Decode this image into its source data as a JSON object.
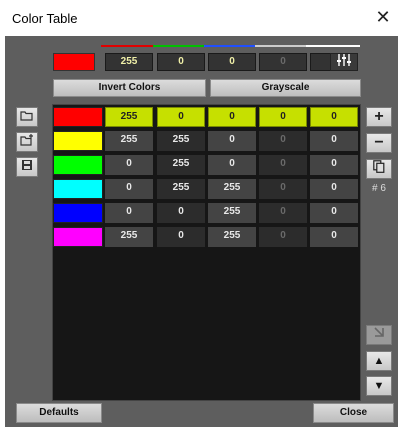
{
  "window": {
    "title": "Color Table",
    "close_glyph": "✕"
  },
  "header": {
    "swatch_color": "#ff0000",
    "channels": [
      {
        "value": "255",
        "dim": false,
        "line_color": "#e00000"
      },
      {
        "value": "0",
        "dim": false,
        "line_color": "#00c000"
      },
      {
        "value": "0",
        "dim": false,
        "line_color": "#2050ff"
      },
      {
        "value": "0",
        "dim": true,
        "line_color": "#cccccc"
      },
      {
        "value": "0",
        "dim": false,
        "line_color": "#ffffff"
      }
    ],
    "settings_icon": "sliders-icon"
  },
  "buttons": {
    "invert": "Invert Colors",
    "grayscale": "Grayscale",
    "defaults": "Defaults",
    "close": "Close"
  },
  "rows": [
    {
      "color": "#ff0000",
      "values": [
        "255",
        "0",
        "0",
        "0",
        "0"
      ],
      "selected": true
    },
    {
      "color": "#ffff00",
      "values": [
        "255",
        "255",
        "0",
        "0",
        "0"
      ],
      "selected": false
    },
    {
      "color": "#00ff00",
      "values": [
        "0",
        "255",
        "0",
        "0",
        "0"
      ],
      "selected": false
    },
    {
      "color": "#00ffff",
      "values": [
        "0",
        "255",
        "255",
        "0",
        "0"
      ],
      "selected": false
    },
    {
      "color": "#0000ff",
      "values": [
        "0",
        "0",
        "255",
        "0",
        "0"
      ],
      "selected": false
    },
    {
      "color": "#ff00ff",
      "values": [
        "255",
        "0",
        "255",
        "0",
        "0"
      ],
      "selected": false
    }
  ],
  "dim_column_index": 3,
  "right_panel": {
    "count": "# 6"
  }
}
